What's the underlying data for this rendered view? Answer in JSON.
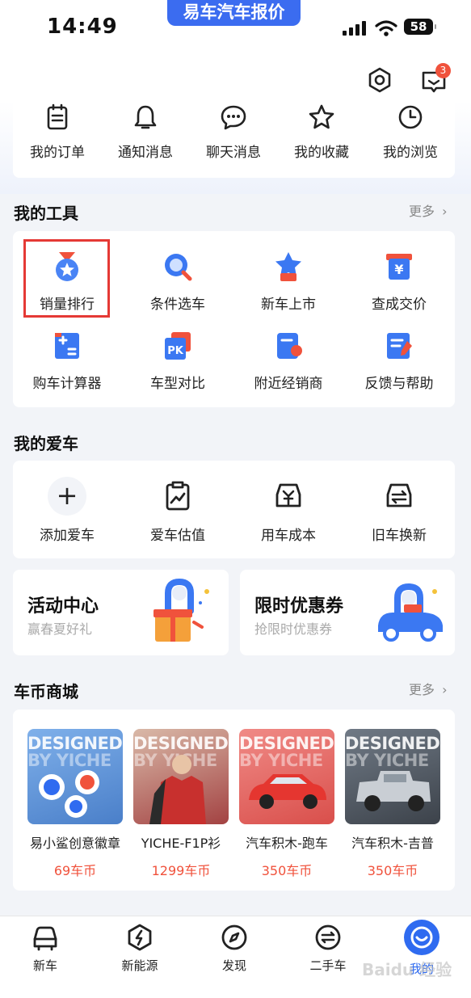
{
  "status_bar": {
    "time": "14:49",
    "app_label": "易车汽车报价",
    "battery": "58"
  },
  "header": {
    "message_count": "3"
  },
  "quick_links": [
    {
      "label": "我的订单",
      "icon": "order-icon"
    },
    {
      "label": "通知消息",
      "icon": "bell-icon"
    },
    {
      "label": "聊天消息",
      "icon": "chat-icon"
    },
    {
      "label": "我的收藏",
      "icon": "star-icon"
    },
    {
      "label": "我的浏览",
      "icon": "clock-icon"
    }
  ],
  "tools": {
    "title": "我的工具",
    "more": "更多",
    "items": [
      {
        "label": "销量排行",
        "icon": "medal-icon"
      },
      {
        "label": "条件选车",
        "icon": "search-car-icon"
      },
      {
        "label": "新车上市",
        "icon": "new-car-icon"
      },
      {
        "label": "查成交价",
        "icon": "price-icon"
      },
      {
        "label": "购车计算器",
        "icon": "calculator-icon"
      },
      {
        "label": "车型对比",
        "icon": "pk-icon"
      },
      {
        "label": "附近经销商",
        "icon": "dealer-icon"
      },
      {
        "label": "反馈与帮助",
        "icon": "feedback-icon"
      }
    ]
  },
  "my_car": {
    "title": "我的爱车",
    "items": [
      {
        "label": "添加爱车",
        "icon": "plus-icon"
      },
      {
        "label": "爱车估值",
        "icon": "valuation-icon"
      },
      {
        "label": "用车成本",
        "icon": "cost-icon"
      },
      {
        "label": "旧车换新",
        "icon": "trade-in-icon"
      }
    ]
  },
  "promos": [
    {
      "title": "活动中心",
      "subtitle": "赢春夏好礼",
      "icon": "gift-icon"
    },
    {
      "title": "限时优惠券",
      "subtitle": "抢限时优惠券",
      "icon": "coupon-car-icon"
    }
  ],
  "mall": {
    "title": "车币商城",
    "more": "更多",
    "watermark_line1": "DESIGNED",
    "watermark_line2": "BY YICHE",
    "products": [
      {
        "name": "易小鲨创意徽章",
        "price": "69车币",
        "color": "#5b8fd6"
      },
      {
        "name": "YICHE-F1P衫",
        "price": "1299车币",
        "color": "#c24a48"
      },
      {
        "name": "汽车积木-跑车",
        "price": "350车币",
        "color": "#d95b58"
      },
      {
        "name": "汽车积木-吉普",
        "price": "350车币",
        "color": "#4a4f57"
      }
    ]
  },
  "tabbar": {
    "items": [
      {
        "label": "新车",
        "icon": "car-front-icon"
      },
      {
        "label": "新能源",
        "icon": "energy-icon"
      },
      {
        "label": "发现",
        "icon": "compass-icon"
      },
      {
        "label": "二手车",
        "icon": "used-car-icon"
      },
      {
        "label": "我的",
        "icon": "profile-icon"
      }
    ],
    "active": "我的",
    "active_color": "#2f6bf0"
  },
  "watermark": "Baidu 经验"
}
